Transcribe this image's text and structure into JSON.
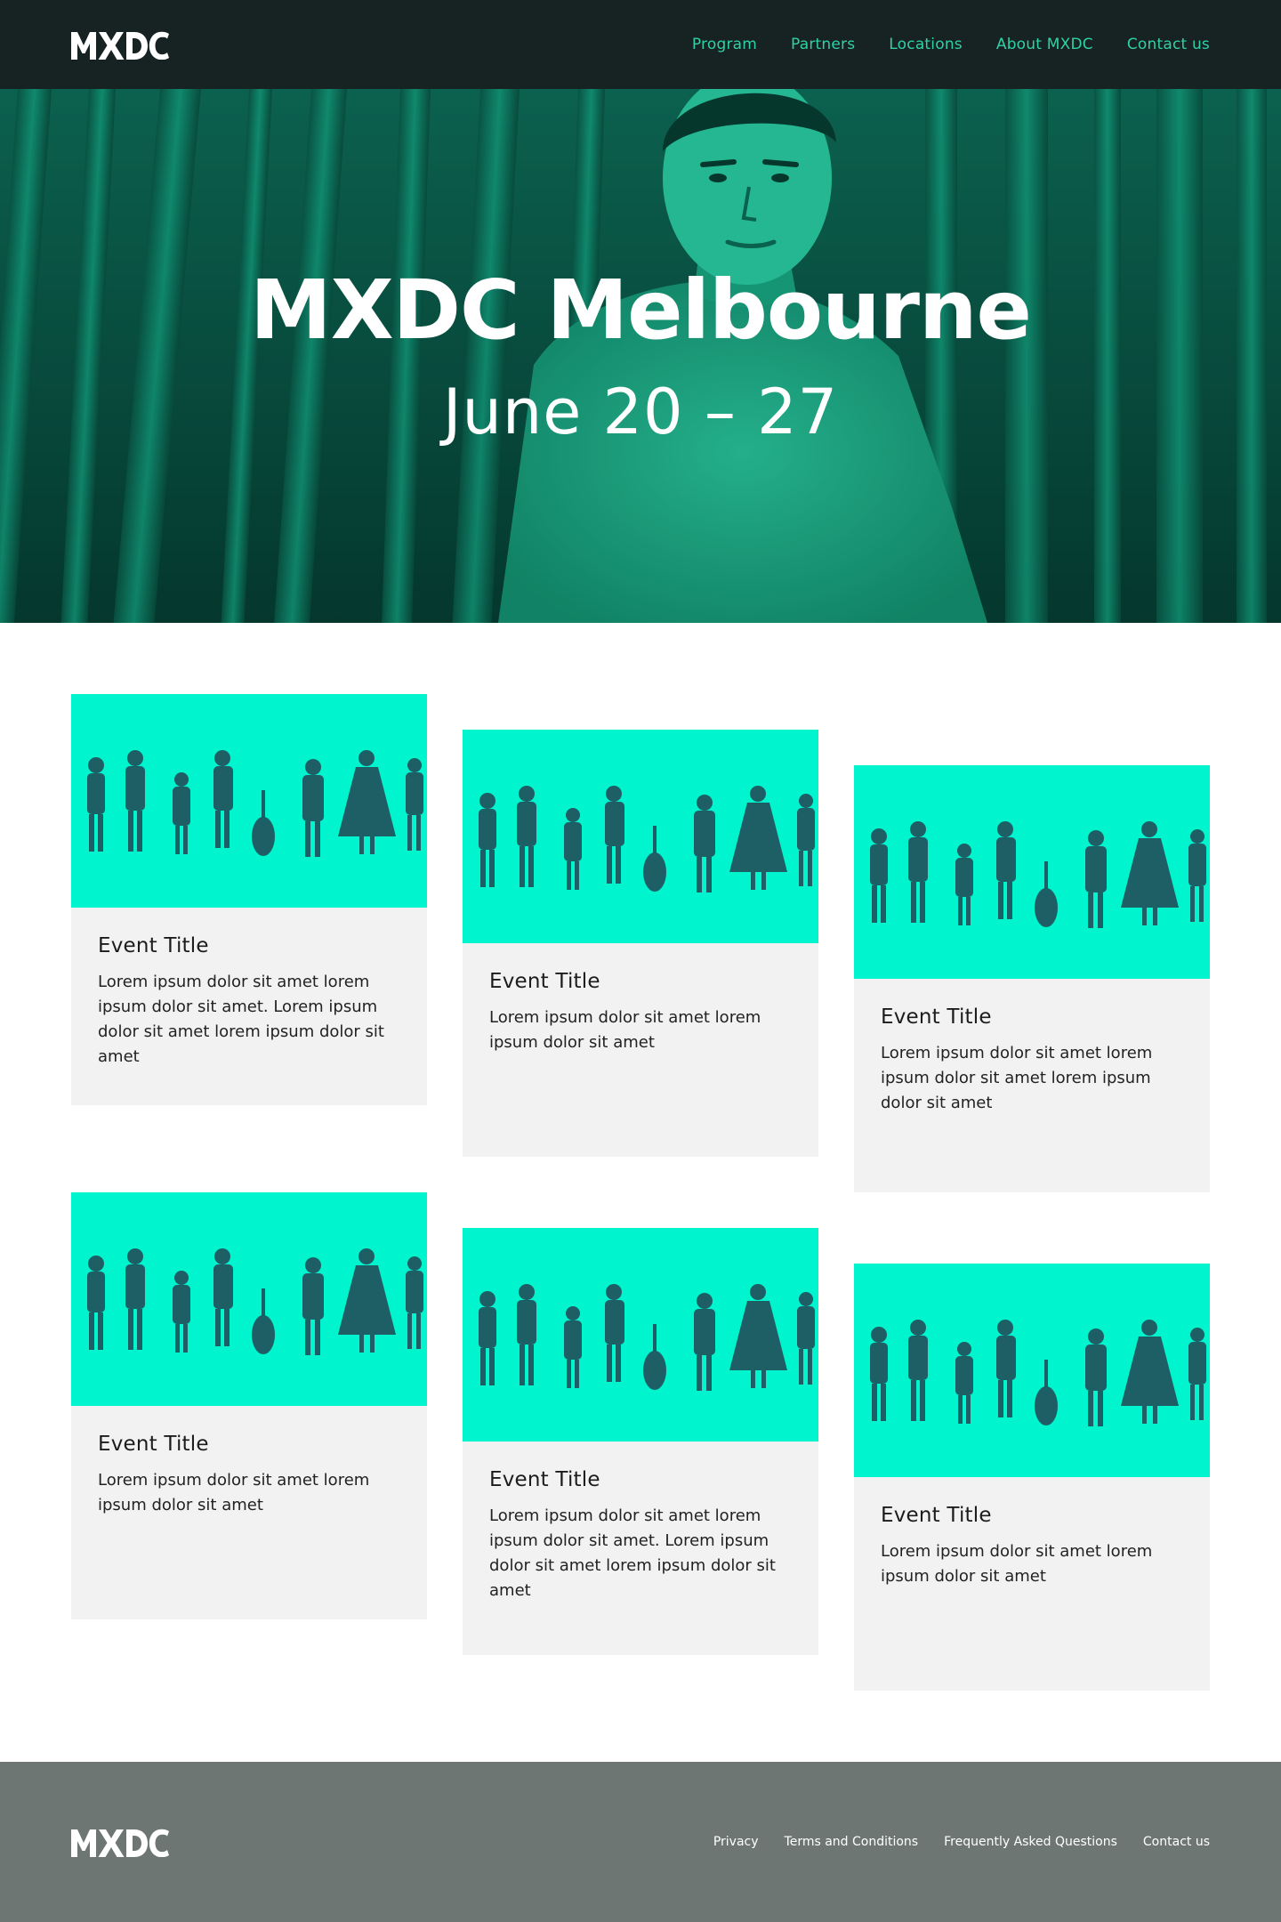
{
  "brand": {
    "logo_text": "MXDC"
  },
  "nav": {
    "items": [
      "Program",
      "Partners",
      "Locations",
      "About MXDC",
      "Contact us"
    ]
  },
  "hero": {
    "title": "MXDC Melbourne",
    "date": "June 20 – 27"
  },
  "cards": [
    {
      "title": "Event Title",
      "text": "Lorem ipsum dolor sit amet lorem ipsum dolor sit amet. Lorem ipsum dolor sit amet lorem ipsum dolor sit amet"
    },
    {
      "title": "Event Title",
      "text": "Lorem ipsum dolor sit amet lorem ipsum dolor sit amet"
    },
    {
      "title": "Event Title",
      "text": "Lorem ipsum dolor sit amet lorem ipsum dolor sit amet lorem ipsum dolor sit amet"
    },
    {
      "title": "Event Title",
      "text": "Lorem ipsum dolor sit amet lorem ipsum dolor sit amet"
    },
    {
      "title": "Event Title",
      "text": "Lorem ipsum dolor sit amet lorem ipsum dolor sit amet. Lorem ipsum dolor sit amet lorem ipsum dolor sit amet"
    },
    {
      "title": "Event Title",
      "text": "Lorem ipsum dolor sit amet lorem ipsum dolor sit amet"
    }
  ],
  "footer": {
    "links": [
      "Privacy",
      "Terms and Conditions",
      "Frequently Asked Questions",
      "Contact us"
    ]
  },
  "colors": {
    "header_bg": "#172322",
    "nav_link": "#2fd1a6",
    "accent_teal": "#00f5cf",
    "hero_dark": "#0a4a3c",
    "card_bg": "#f2f2f2",
    "footer_bg": "#6e7673"
  }
}
